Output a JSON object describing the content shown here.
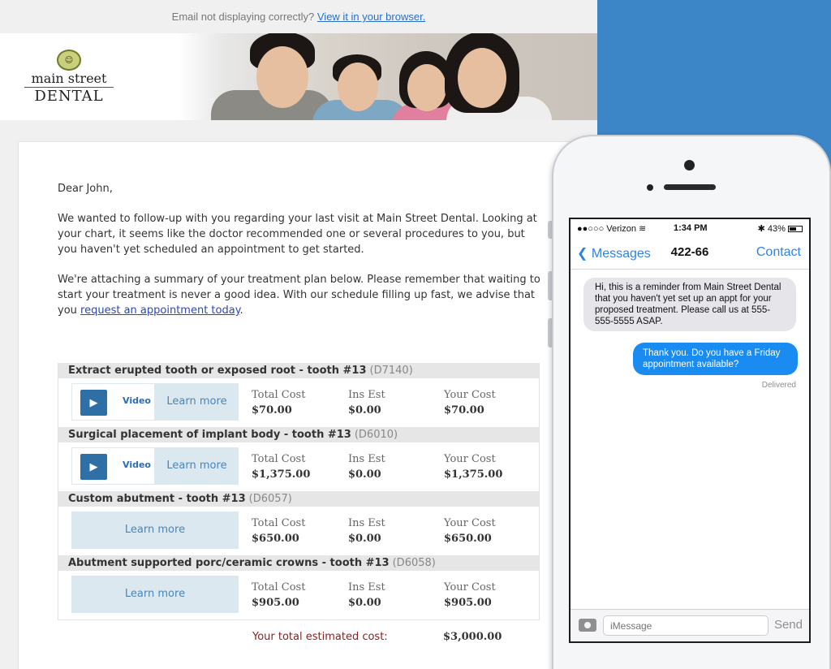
{
  "email": {
    "preheader_text": "Email not displaying correctly?",
    "preheader_link": "View it in your browser.",
    "logo": {
      "line1": "main street",
      "line2": "DENTAL"
    },
    "greeting": "Dear John,",
    "para1": "We wanted to follow-up with you regarding your last visit at Main Street Dental. Looking at your chart, it seems like the doctor recommended one or several procedures to you, but you haven't yet scheduled an appointment to get started.",
    "para2_before": "We're attaching a summary of your treatment plan below. Please remember that waiting to start your treatment is never a good idea. With our schedule filling up fast, we advise that you ",
    "para2_link": "request an appointment today",
    "para2_after": ".",
    "labels": {
      "total_cost": "Total Cost",
      "ins_est": "Ins Est",
      "your_cost": "Your Cost",
      "video": "Video",
      "learn_more": "Learn more"
    },
    "procedures": [
      {
        "name": "Extract erupted tooth or exposed root - tooth #13",
        "code": "(D7140)",
        "total": "$70.00",
        "ins": "$0.00",
        "yours": "$70.00"
      },
      {
        "name": "Surgical placement of implant body - tooth #13",
        "code": "(D6010)",
        "total": "$1,375.00",
        "ins": "$0.00",
        "yours": "$1,375.00"
      },
      {
        "name": "Custom abutment - tooth #13",
        "code": "(D6057)",
        "total": "$650.00",
        "ins": "$0.00",
        "yours": "$650.00"
      },
      {
        "name": "Abutment supported porc/ceramic crowns - tooth #13",
        "code": "(D6058)",
        "total": "$905.00",
        "ins": "$0.00",
        "yours": "$905.00"
      }
    ],
    "total_label": "Your total estimated cost:",
    "total_value": "$3,000.00"
  },
  "phone": {
    "carrier": "●●○○○ Verizon",
    "time": "1:34 PM",
    "battery": "43%",
    "back_label": "Messages",
    "thread_title": "422-66",
    "contact_label": "Contact",
    "incoming": "Hi, this is a reminder from Main Street Dental that you haven't yet set up an appt for your proposed treatment. Please call us at 555-555-5555 ASAP.",
    "outgoing": "Thank you. Do you have a Friday appointment available?",
    "delivered": "Delivered",
    "input_placeholder": "iMessage",
    "send_label": "Send"
  },
  "colors": {
    "background_right": "#3c85c6",
    "imessage_blue": "#1a8bf0",
    "learn_more_bg": "#dce8ef",
    "total_label": "#8a1e1e"
  }
}
